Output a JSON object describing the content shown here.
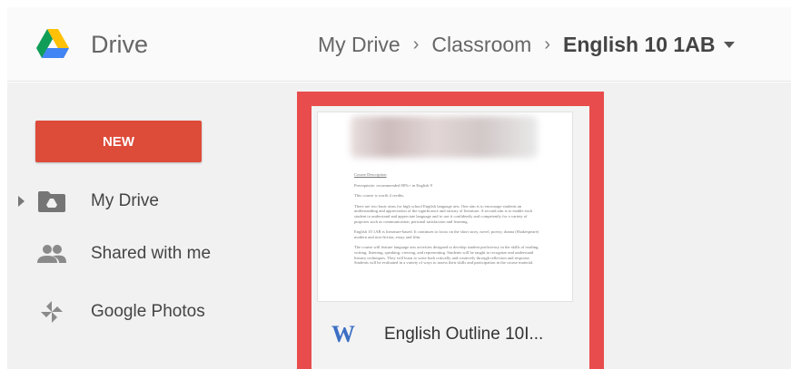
{
  "app": {
    "name": "Drive"
  },
  "breadcrumb": {
    "items": [
      "My Drive",
      "Classroom"
    ],
    "current": "English 10 1AB"
  },
  "sidebar": {
    "new_label": "NEW",
    "items": [
      {
        "label": "My Drive",
        "icon": "drive-folder-icon"
      },
      {
        "label": "Shared with me",
        "icon": "people-icon"
      },
      {
        "label": "Google Photos",
        "icon": "pinwheel-icon"
      }
    ]
  },
  "file": {
    "name": "English Outline 10I...",
    "type_icon": "W",
    "preview": {
      "heading": "Course Description",
      "lines": [
        "Prerequisite: recommended 80%+ in English 9",
        "This course is worth 4 credits.",
        "There are two basic aims for high school English language arts. One aim is to encourage students an understanding and appreciation of the significance and artistry of literature. A second aim is to enable each student to understand and appreciate language and to use it confidently and competently for a variety of purposes such as communication, personal satisfaction and learning.",
        "English 10 1AB is literature-based. It continues to focus on the short story, novel, poetry, drama (Shakespeare) modern and non-fiction, essay and film.",
        "The course will feature language arts activities designed to develop student proficiency in the skills of reading, writing, listening, speaking, viewing, and representing. Students will be taught to recognize and understand literary techniques. They will learn to write both critically and creatively through reflection and response. Students will be evaluated in a variety of ways to assess their skills and participation in the course material."
      ]
    }
  },
  "colors": {
    "new_button": "#dd4b39",
    "highlight": "#e84c4c",
    "word_blue": "#3b6fc4"
  }
}
